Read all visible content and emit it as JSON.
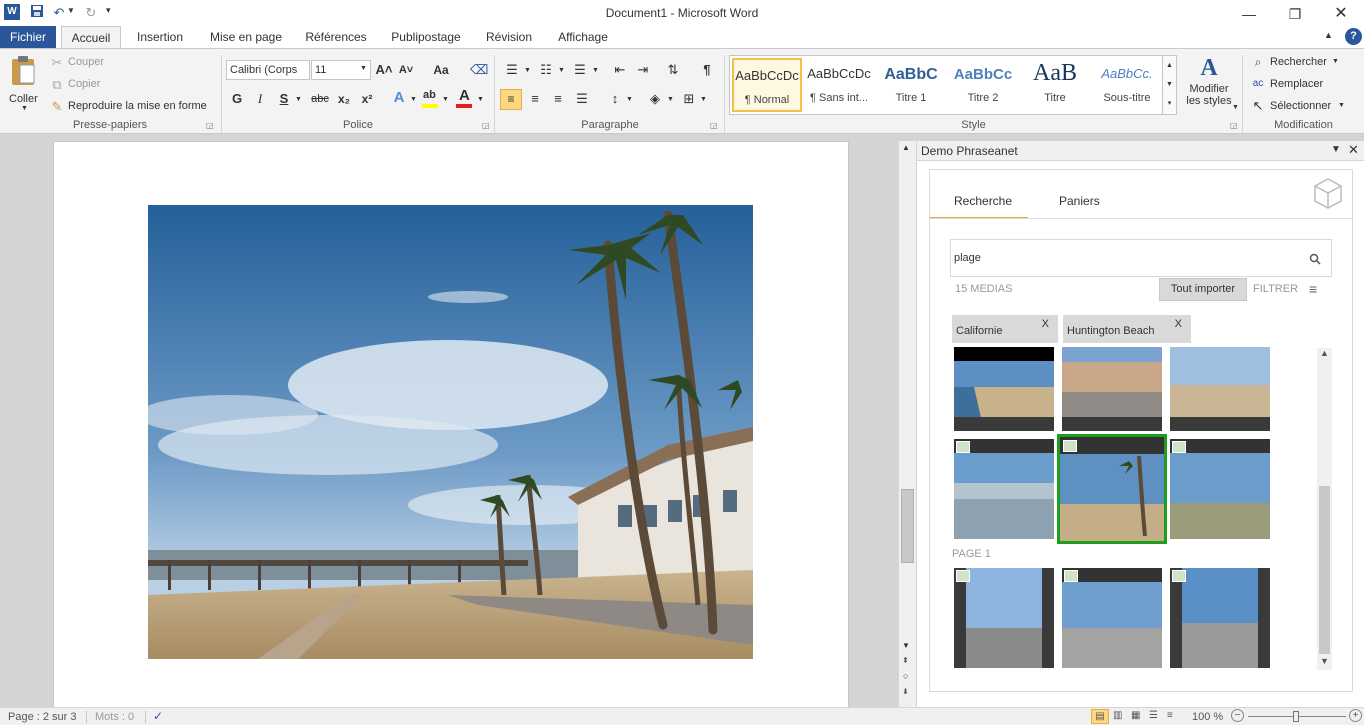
{
  "window": {
    "title": "Document1 - Microsoft Word"
  },
  "quick_access": {
    "undo_icon": "undo-icon",
    "redo_icon": "redo-icon",
    "save_icon": "save-icon"
  },
  "tabs": [
    "Fichier",
    "Accueil",
    "Insertion",
    "Mise en page",
    "Références",
    "Publipostage",
    "Révision",
    "Affichage"
  ],
  "clipboard": {
    "paste": "Coller",
    "cut": "Couper",
    "copy": "Copier",
    "format_painter": "Reproduire la mise en forme",
    "group": "Presse-papiers"
  },
  "font": {
    "name": "Calibri (Corps",
    "size": "11",
    "group": "Police",
    "bold": "G",
    "italic": "I",
    "underline": "S",
    "strike": "abc",
    "sub": "x₂",
    "sup": "x²",
    "grow": "A˄",
    "shrink": "A˅",
    "case": "Aa"
  },
  "paragraph": {
    "group": "Paragraphe",
    "pilcrow": "¶"
  },
  "styles": {
    "group": "Style",
    "items": [
      {
        "preview": "AaBbCcDc",
        "name": "¶ Normal"
      },
      {
        "preview": "AaBbCcDc",
        "name": "¶ Sans int..."
      },
      {
        "preview": "AaBbC",
        "name": "Titre 1"
      },
      {
        "preview": "AaBbCc",
        "name": "Titre 2"
      },
      {
        "preview": "AaB",
        "name": "Titre"
      },
      {
        "preview": "AaBbCc.",
        "name": "Sous-titre"
      }
    ],
    "modify_line1": "Modifier",
    "modify_line2": "les styles"
  },
  "editing": {
    "group": "Modification",
    "find": "Rechercher",
    "replace": "Remplacer",
    "select": "Sélectionner"
  },
  "pane": {
    "title": "Demo Phraseanet",
    "tab_search": "Recherche",
    "tab_baskets": "Paniers",
    "search_value": "plage",
    "media_count": "15 MEDIAS",
    "import_all": "Tout importer",
    "filter": "FILTRER",
    "chips": [
      {
        "label": "Californie",
        "remove": "X"
      },
      {
        "label": "Huntington Beach",
        "remove": "X"
      }
    ],
    "page_label": "PAGE 1"
  },
  "status": {
    "page": "Page : 2 sur 3",
    "words": "Mots : 0",
    "zoom": "100 %",
    "zoom_level": 1.0
  },
  "colors": {
    "brand": "#2b579a",
    "selected": "#1e9e1e",
    "accent": "#e8a33d"
  }
}
